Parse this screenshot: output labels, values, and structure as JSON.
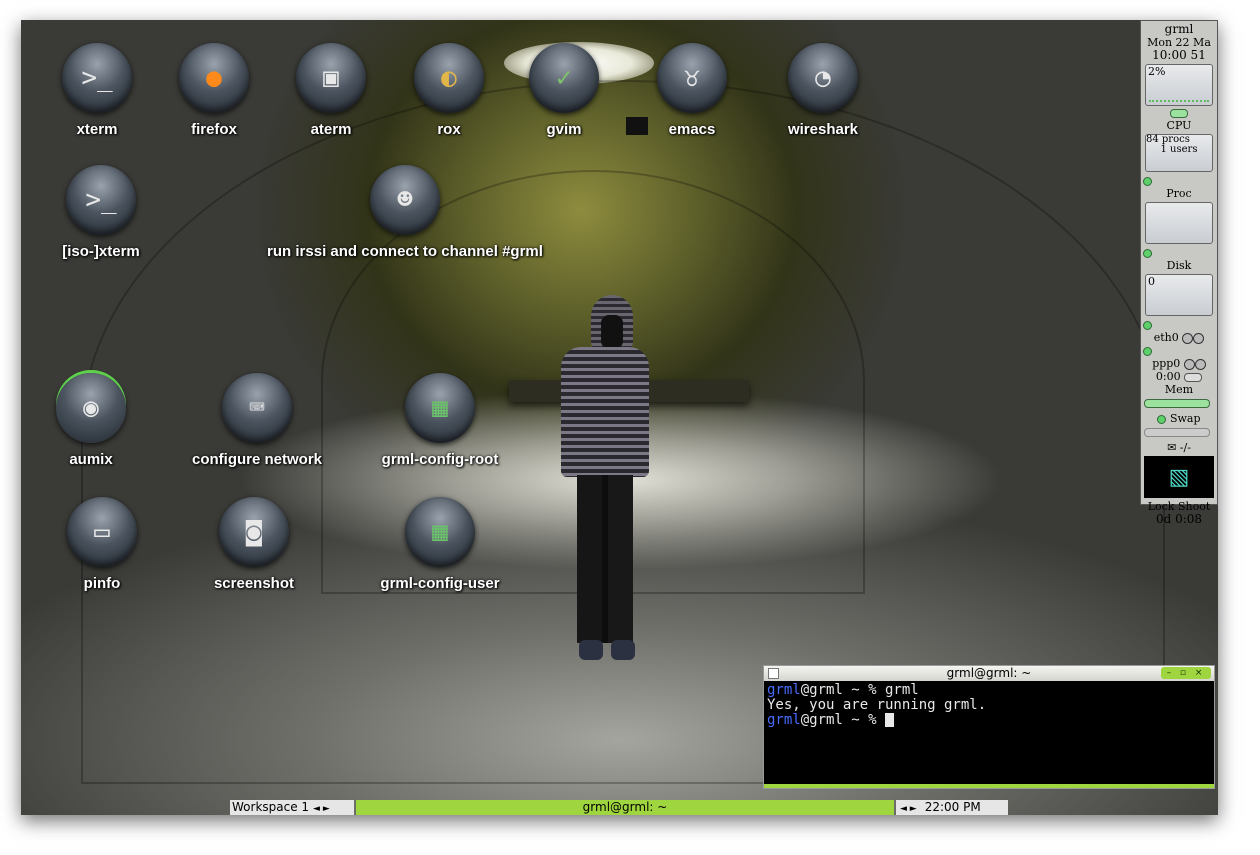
{
  "desktop_icons": {
    "xterm": {
      "label": "xterm",
      "icon": "terminal-icon"
    },
    "firefox": {
      "label": "firefox",
      "icon": "firefox-icon"
    },
    "aterm": {
      "label": "aterm",
      "icon": "aterm-icon"
    },
    "rox": {
      "label": "rox",
      "icon": "rox-icon"
    },
    "gvim": {
      "label": "gvim",
      "icon": "gvim-icon"
    },
    "emacs": {
      "label": "emacs",
      "icon": "emacs-icon"
    },
    "wireshark": {
      "label": "wireshark",
      "icon": "wireshark-icon"
    },
    "iso_xterm": {
      "label": "[iso-]xterm",
      "icon": "terminal-icon"
    },
    "irssi": {
      "label": "run irssi and connect to channel #grml",
      "icon": "irssi-icon"
    },
    "aumix": {
      "label": "aumix",
      "icon": "speaker-icon"
    },
    "configure_network": {
      "label": "configure network",
      "icon": "network-icon"
    },
    "grml_config_root": {
      "label": "grml-config-root",
      "icon": "config-icon"
    },
    "pinfo": {
      "label": "pinfo",
      "icon": "book-icon"
    },
    "screenshot": {
      "label": "screenshot",
      "icon": "camera-icon"
    },
    "grml_config_user": {
      "label": "grml-config-user",
      "icon": "config-icon"
    }
  },
  "dock": {
    "title": "grml",
    "date": "Mon 22 Ma",
    "time": "10:00 51",
    "cpu_percent": "2%",
    "cpu_label": "CPU",
    "procs": "84 procs",
    "users": "1 users",
    "proc_label": "Proc",
    "disk_label": "Disk",
    "disk_value": "0",
    "eth_label": "eth0",
    "ppp_label": "ppp0",
    "ppp_time": "0:00",
    "mem_label": "Mem",
    "swap_label": "Swap",
    "mail": "-/-",
    "lock_label": "Lock",
    "shoot_label": "Shoot",
    "uptime": "0d  0:08"
  },
  "terminal": {
    "title": "grml@grml: ~",
    "buttons": "– ▫ ×",
    "line1_user": "grml",
    "line1_rest": "@grml ~ % grml",
    "line2": "Yes, you are running grml.",
    "line3_user": "grml",
    "line3_rest": "@grml ~ % "
  },
  "taskbar": {
    "workspace": "Workspace 1",
    "workspace_arrows": "◄ ►",
    "task": "grml@grml: ~",
    "clock_arrows": "◄ ►",
    "clock": "22:00 PM"
  },
  "colors": {
    "accent": "#9fd63f",
    "prompt_user": "#4a6cff"
  }
}
